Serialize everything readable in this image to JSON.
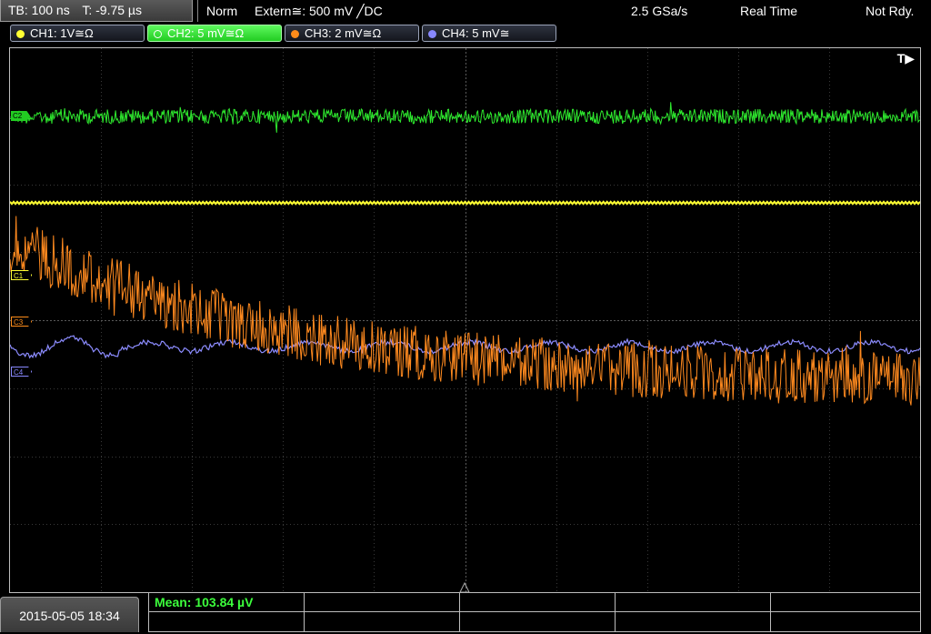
{
  "topbar": {
    "timebase": "TB: 100 ns",
    "trigger_time": "T: -9.75 µs",
    "acq_mode": "Norm",
    "trigger_source": "Extern≅: 500 mV ╱DC",
    "sample_rate": "2.5 GSa/s",
    "mode": "Real Time",
    "status": "Not Rdy."
  },
  "channels": [
    {
      "label": "CH1: 1V≅Ω",
      "color": "#ffff33",
      "active": false
    },
    {
      "label": "CH2: 5 mV≅Ω",
      "color": "#33ee33",
      "active": true
    },
    {
      "label": "CH3: 2 mV≅Ω",
      "color": "#ff8c1a",
      "active": false
    },
    {
      "label": "CH4: 5 mV≅",
      "color": "#8888ff",
      "active": false
    }
  ],
  "markers": {
    "ch2": "C2",
    "ch1": "C1",
    "ch3": "C3",
    "ch4": "C4"
  },
  "trigger_marker": "T▶",
  "datetime": "2015-05-05 18:34",
  "measurement": {
    "mean": "Mean: 103.84 µV"
  }
}
